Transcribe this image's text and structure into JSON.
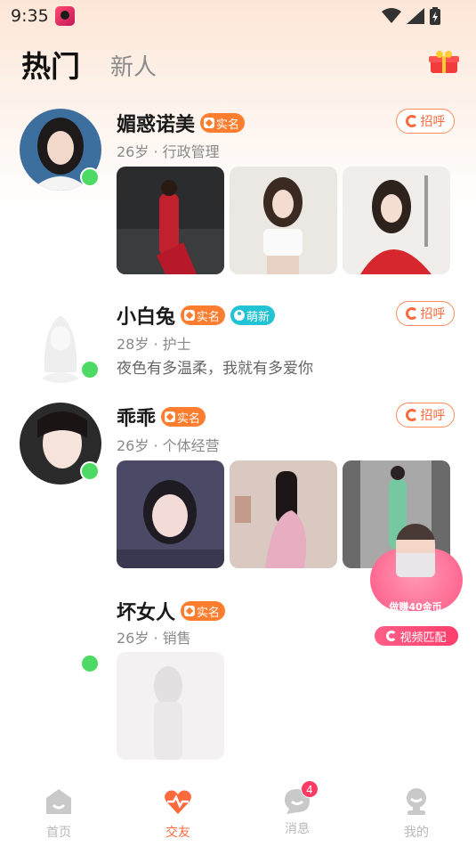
{
  "status_bar": {
    "time": "9:35"
  },
  "header": {
    "tab_hot": "热门",
    "tab_new": "新人"
  },
  "users": [
    {
      "name": "媚惑诺美",
      "badges": [
        "实名"
      ],
      "meta": "26岁 · 行政管理",
      "greet": "招呼",
      "photos": 3
    },
    {
      "name": "小白兔",
      "badges": [
        "实名",
        "萌新"
      ],
      "meta": "28岁 · 护士",
      "bio": "夜色有多温柔，我就有多爱你",
      "greet": "招呼"
    },
    {
      "name": "乖乖",
      "badges": [
        "实名"
      ],
      "meta": "26岁 · 个体经营",
      "greet": "招呼",
      "photos": 3
    },
    {
      "name": "坏女人",
      "badges": [
        "实名"
      ],
      "meta": "26岁 · 销售",
      "photos": 1
    }
  ],
  "promo": {
    "text": "做赚40金币",
    "button": "视频匹配"
  },
  "tab_bar": {
    "items": [
      {
        "label": "首页",
        "icon": "home-icon"
      },
      {
        "label": "交友",
        "icon": "heart-pulse-icon",
        "active": true
      },
      {
        "label": "消息",
        "icon": "chat-icon",
        "badge": "4"
      },
      {
        "label": "我的",
        "icon": "profile-icon"
      }
    ]
  },
  "colors": {
    "accent": "#ff6a3d",
    "badge_real": "#ff7d2e",
    "badge_cute": "#23c3d6",
    "online": "#4cd964"
  }
}
